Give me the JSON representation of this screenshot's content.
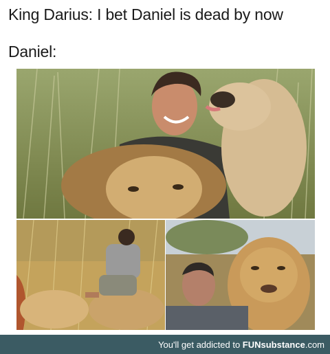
{
  "captions": {
    "line1": "King Darius: I bet Daniel is dead by now",
    "line2": "Daniel:"
  },
  "footer": {
    "text": "You'll get addicted to ",
    "brand_bold": "FUN",
    "brand_rest": "substance",
    "brand_tld": ".com"
  },
  "photos": {
    "top_alt": "man hugging lions",
    "bottom_left_alt": "man riding lion",
    "bottom_right_alt": "man resting with lion"
  },
  "colors": {
    "footer_bg": "#3b5b63",
    "grass": "#8f9b5c",
    "lion": "#c9a36a"
  }
}
